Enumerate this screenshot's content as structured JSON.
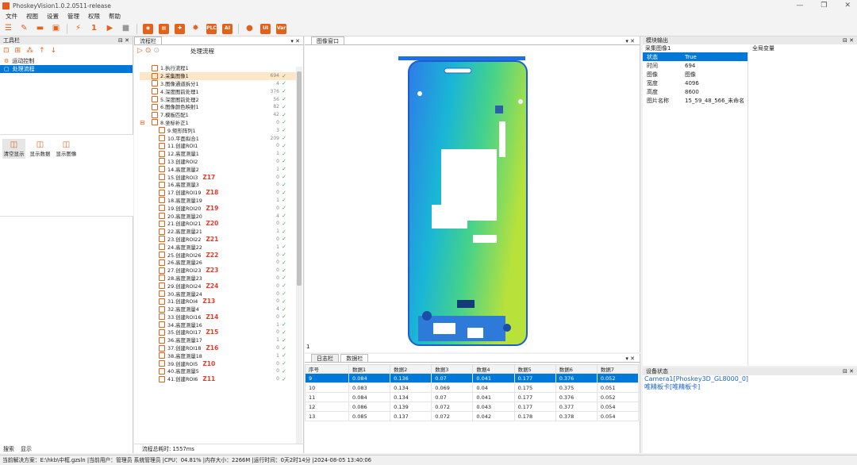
{
  "window": {
    "title": "PhoskeyVision1.0.2.0511-release",
    "min": "—",
    "max": "❐",
    "close": "✕"
  },
  "menu": [
    "文件",
    "视图",
    "设置",
    "管理",
    "权限",
    "帮助"
  ],
  "toolbar": {
    "flow_one_label": "1",
    "plc_label": "PLC",
    "ai_label": "AI",
    "ui_label": "UI",
    "var_label": "Var"
  },
  "left_panel": {
    "title": "工具栏",
    "pin": "⊟",
    "close": "✕",
    "tree": [
      {
        "label": "运动控制"
      },
      {
        "label": "处理流程"
      }
    ],
    "quick_buttons": [
      {
        "label": "清空显示"
      },
      {
        "label": "显示数据"
      },
      {
        "label": "显示图像"
      }
    ],
    "bottom_tabs": [
      "搜索",
      "显示"
    ]
  },
  "flow_panel": {
    "tab": "流程栏",
    "title": "处理流程",
    "total_time_label": "流程总耗时:",
    "total_time": "1557ms",
    "steps": [
      {
        "label": "1.执行流程1",
        "value": "",
        "z": ""
      },
      {
        "label": "2.采集图像1",
        "value": "694",
        "z": ""
      },
      {
        "label": "3.图像通道拆分1",
        "value": "4",
        "z": ""
      },
      {
        "label": "4.深度图前处理1",
        "value": "376",
        "z": ""
      },
      {
        "label": "5.深度图前处理2",
        "value": "56",
        "z": ""
      },
      {
        "label": "6.图像颜色映射1",
        "value": "82",
        "z": ""
      },
      {
        "label": "7.模板匹配1",
        "value": "42",
        "z": ""
      },
      {
        "label": "8.坐标补正1",
        "value": "0",
        "z": ""
      },
      {
        "label": "9.矩形阵列1",
        "value": "3",
        "z": ""
      },
      {
        "label": "10.平面拟合1",
        "value": "209",
        "z": ""
      },
      {
        "label": "11.创建ROI1",
        "value": "0",
        "z": ""
      },
      {
        "label": "12.高度测量1",
        "value": "1",
        "z": ""
      },
      {
        "label": "13.创建ROI2",
        "value": "0",
        "z": ""
      },
      {
        "label": "14.高度测量2",
        "value": "1",
        "z": ""
      },
      {
        "label": "15.创建ROI3",
        "value": "0",
        "z": "Z17"
      },
      {
        "label": "16.高度测量3",
        "value": "0",
        "z": ""
      },
      {
        "label": "17.创建ROI19",
        "value": "0",
        "z": "Z18"
      },
      {
        "label": "18.高度测量19",
        "value": "1",
        "z": ""
      },
      {
        "label": "19.创建ROI20",
        "value": "0",
        "z": "Z19"
      },
      {
        "label": "20.高度测量20",
        "value": "4",
        "z": ""
      },
      {
        "label": "21.创建ROI21",
        "value": "0",
        "z": "Z20"
      },
      {
        "label": "22.高度测量21",
        "value": "1",
        "z": ""
      },
      {
        "label": "23.创建ROI22",
        "value": "0",
        "z": "Z21"
      },
      {
        "label": "24.高度测量22",
        "value": "1",
        "z": ""
      },
      {
        "label": "25.创建ROI26",
        "value": "0",
        "z": "Z22"
      },
      {
        "label": "26.高度测量26",
        "value": "0",
        "z": ""
      },
      {
        "label": "27.创建ROI23",
        "value": "0",
        "z": "Z23"
      },
      {
        "label": "28.高度测量23",
        "value": "0",
        "z": ""
      },
      {
        "label": "29.创建ROI24",
        "value": "0",
        "z": "Z24"
      },
      {
        "label": "30.高度测量24",
        "value": "0",
        "z": ""
      },
      {
        "label": "31.创建ROI4",
        "value": "0",
        "z": "Z13"
      },
      {
        "label": "32.高度测量4",
        "value": "4",
        "z": ""
      },
      {
        "label": "33.创建ROI16",
        "value": "0",
        "z": "Z14"
      },
      {
        "label": "34.高度测量16",
        "value": "1",
        "z": ""
      },
      {
        "label": "35.创建ROI17",
        "value": "0",
        "z": "Z15"
      },
      {
        "label": "36.高度测量17",
        "value": "1",
        "z": ""
      },
      {
        "label": "37.创建ROI18",
        "value": "0",
        "z": "Z16"
      },
      {
        "label": "38.高度测量18",
        "value": "1",
        "z": ""
      },
      {
        "label": "39.创建ROI5",
        "value": "0",
        "z": "Z10"
      },
      {
        "label": "40.高度测量5",
        "value": "0",
        "z": ""
      },
      {
        "label": "41.创建ROI6",
        "value": "0",
        "z": "Z11"
      }
    ]
  },
  "image_panel": {
    "tab": "图像窗口",
    "label": "1"
  },
  "data_panel": {
    "tabs": [
      "日志栏",
      "数据栏"
    ],
    "headers": [
      "序号",
      "数据1",
      "数据2",
      "数据3",
      "数据4",
      "数据5",
      "数据6",
      "数据7"
    ],
    "rows": [
      [
        "9",
        "0.084",
        "0.136",
        "0.07",
        "0.041",
        "0.177",
        "0.376",
        "0.052"
      ],
      [
        "10",
        "0.083",
        "0.134",
        "0.069",
        "0.04",
        "0.175",
        "0.375",
        "0.051"
      ],
      [
        "11",
        "0.084",
        "0.134",
        "0.07",
        "0.041",
        "0.177",
        "0.376",
        "0.052"
      ],
      [
        "12",
        "0.086",
        "0.139",
        "0.072",
        "0.043",
        "0.177",
        "0.377",
        "0.054"
      ],
      [
        "13",
        "0.085",
        "0.137",
        "0.072",
        "0.042",
        "0.178",
        "0.378",
        "0.054"
      ]
    ]
  },
  "module_output": {
    "title": "模块输出",
    "global_var": "全局变量",
    "item": "采集图像1",
    "rows": [
      [
        "状态",
        "True"
      ],
      [
        "时间",
        "694"
      ],
      [
        "图像",
        "图像"
      ],
      [
        "宽度",
        "4096"
      ],
      [
        "高度",
        "8600"
      ],
      [
        "图片名称",
        "15_59_48_566_未命名"
      ]
    ]
  },
  "device_status": {
    "title": "设备状态",
    "items": [
      "Camera1[Phoskey3D_GL8000_0]",
      "唯精板卡[唯精板卡]"
    ]
  },
  "status_bar": "当前解决方案：E:\\hkb\\中框.gzsln   |当前用户：管理员 系统管理员   |CPU：04.81%   |内存大小：2266M   |运行时间：0天2时14分   |2024-08-05 13:40:06"
}
